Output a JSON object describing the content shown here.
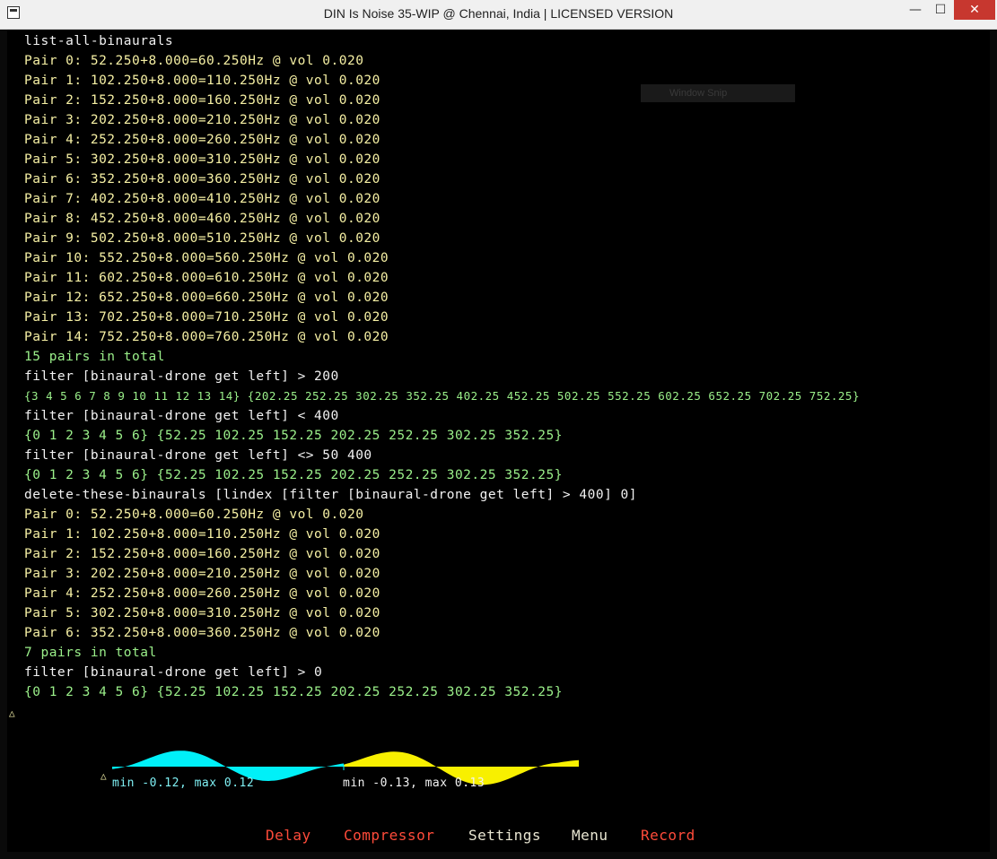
{
  "window": {
    "title": "DIN Is Noise 35-WIP @ Chennai, India | LICENSED VERSION",
    "min_glyph": "—",
    "max_glyph": "☐",
    "close_glyph": "✕"
  },
  "overlay": {
    "snip_label": "Window Snip"
  },
  "console": {
    "lines": [
      {
        "text": "list-all-binaurals",
        "color": "white"
      },
      {
        "text": "Pair 0: 52.250+8.000=60.250Hz @ vol 0.020",
        "color": "yellow"
      },
      {
        "text": "Pair 1: 102.250+8.000=110.250Hz @ vol 0.020",
        "color": "yellow"
      },
      {
        "text": "Pair 2: 152.250+8.000=160.250Hz @ vol 0.020",
        "color": "yellow"
      },
      {
        "text": "Pair 3: 202.250+8.000=210.250Hz @ vol 0.020",
        "color": "yellow"
      },
      {
        "text": "Pair 4: 252.250+8.000=260.250Hz @ vol 0.020",
        "color": "yellow"
      },
      {
        "text": "Pair 5: 302.250+8.000=310.250Hz @ vol 0.020",
        "color": "yellow"
      },
      {
        "text": "Pair 6: 352.250+8.000=360.250Hz @ vol 0.020",
        "color": "yellow"
      },
      {
        "text": "Pair 7: 402.250+8.000=410.250Hz @ vol 0.020",
        "color": "yellow"
      },
      {
        "text": "Pair 8: 452.250+8.000=460.250Hz @ vol 0.020",
        "color": "yellow"
      },
      {
        "text": "Pair 9: 502.250+8.000=510.250Hz @ vol 0.020",
        "color": "yellow"
      },
      {
        "text": "Pair 10: 552.250+8.000=560.250Hz @ vol 0.020",
        "color": "yellow"
      },
      {
        "text": "Pair 11: 602.250+8.000=610.250Hz @ vol 0.020",
        "color": "yellow"
      },
      {
        "text": "Pair 12: 652.250+8.000=660.250Hz @ vol 0.020",
        "color": "yellow"
      },
      {
        "text": "Pair 13: 702.250+8.000=710.250Hz @ vol 0.020",
        "color": "yellow"
      },
      {
        "text": "Pair 14: 752.250+8.000=760.250Hz @ vol 0.020",
        "color": "yellow"
      },
      {
        "text": "15 pairs in total",
        "color": "green"
      },
      {
        "text": "filter [binaural-drone get left] > 200",
        "color": "white"
      },
      {
        "text": "{3 4 5 6 7 8 9 10 11 12 13 14} {202.25 252.25 302.25 352.25 402.25 452.25 502.25 552.25 602.25 652.25 702.25 752.25}",
        "color": "green",
        "small": true
      },
      {
        "text": "filter [binaural-drone get left] < 400",
        "color": "white"
      },
      {
        "text": "{0 1 2 3 4 5 6} {52.25 102.25 152.25 202.25 252.25 302.25 352.25}",
        "color": "green"
      },
      {
        "text": "filter [binaural-drone get left] <> 50 400",
        "color": "white"
      },
      {
        "text": "{0 1 2 3 4 5 6} {52.25 102.25 152.25 202.25 252.25 302.25 352.25}",
        "color": "green"
      },
      {
        "text": "delete-these-binaurals [lindex [filter [binaural-drone get left] > 400] 0]",
        "color": "white"
      },
      {
        "text": "Pair 0: 52.250+8.000=60.250Hz @ vol 0.020",
        "color": "yellow"
      },
      {
        "text": "Pair 1: 102.250+8.000=110.250Hz @ vol 0.020",
        "color": "yellow"
      },
      {
        "text": "Pair 2: 152.250+8.000=160.250Hz @ vol 0.020",
        "color": "yellow"
      },
      {
        "text": "Pair 3: 202.250+8.000=210.250Hz @ vol 0.020",
        "color": "yellow"
      },
      {
        "text": "Pair 4: 252.250+8.000=260.250Hz @ vol 0.020",
        "color": "yellow"
      },
      {
        "text": "Pair 5: 302.250+8.000=310.250Hz @ vol 0.020",
        "color": "yellow"
      },
      {
        "text": "Pair 6: 352.250+8.000=360.250Hz @ vol 0.020",
        "color": "yellow"
      },
      {
        "text": "7 pairs in total",
        "color": "green"
      },
      {
        "text": "filter [binaural-drone get left] > 0",
        "color": "white"
      },
      {
        "text": "{0 1 2 3 4 5 6} {52.25 102.25 152.25 202.25 252.25 302.25 352.25}",
        "color": "green"
      }
    ]
  },
  "markers": {
    "cursor": "△",
    "scope": "△"
  },
  "scope": {
    "left_label": "min -0.12, max 0.12",
    "right_label": "min -0.13, max 0.13",
    "left_color": "#00f0f8",
    "right_color": "#f8f000"
  },
  "menu": {
    "delay": "Delay",
    "compressor": "Compressor",
    "settings": "Settings",
    "menu": "Menu",
    "record": "Record"
  },
  "colors": {
    "white": "#f2f2f2",
    "yellow": "#f6f0a4",
    "green": "#9bf08a",
    "menu_red": "#ff4b3a"
  }
}
